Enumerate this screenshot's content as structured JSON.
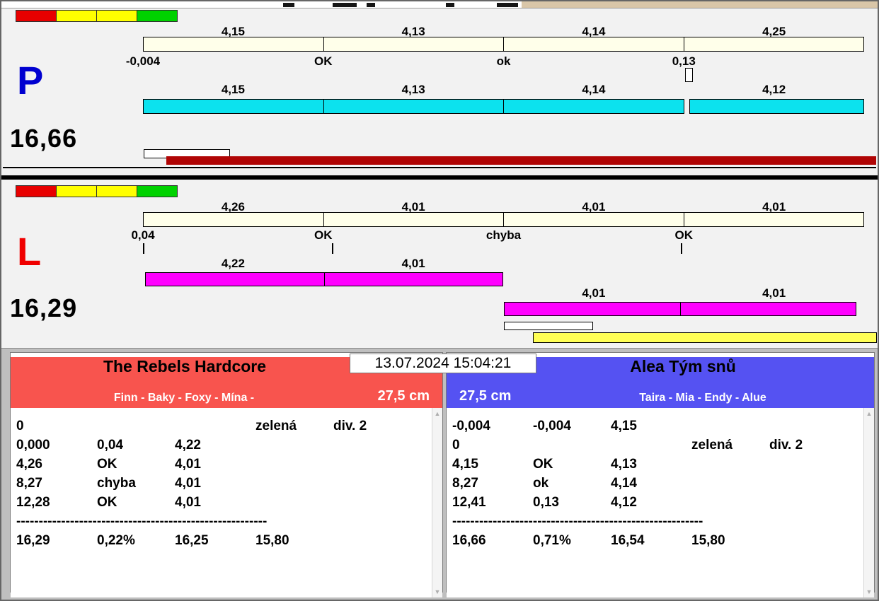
{
  "colors": {
    "section_bg": "#f2f2f2",
    "bottom_bg": "#bfbfbf",
    "cream_bar": "#ffffea",
    "cyan_bar": "#0ce2ee",
    "magenta_bar": "#ff00ff",
    "red_progress": "#b00505",
    "yellow_progress": "#ffff55",
    "left_header": "#f8544e",
    "right_header": "#5552f2",
    "p_letter": "#0000d0",
    "l_letter": "#f00000",
    "tan_strip": "#d9c6a8",
    "lights": [
      "#e80000",
      "#ffff00",
      "#ffff00",
      "#00d200"
    ]
  },
  "lane_p": {
    "label": "P",
    "total": "16,66",
    "split_values": [
      "4,15",
      "4,13",
      "4,14",
      "4,25"
    ],
    "status_values": [
      "-0,004",
      "OK",
      "ok",
      "0,13"
    ],
    "time_values": [
      "4,15",
      "4,13",
      "4,14",
      "4,12"
    ]
  },
  "lane_l": {
    "label": "L",
    "total": "16,29",
    "split_values": [
      "4,26",
      "4,01",
      "4,01",
      "4,01"
    ],
    "status_values": [
      "0,04",
      "OK",
      "chyba",
      "OK"
    ],
    "bar1_values": [
      "4,22",
      "4,01"
    ],
    "bar2_values": [
      "4,01",
      "4,01"
    ]
  },
  "timestamp": "13.07.2024 15:04:21",
  "team_left": {
    "name": "The Rebels Hardcore",
    "members": "Finn - Baky - Foxy - Mína -",
    "height": "27,5 cm",
    "rows": [
      [
        "0",
        "",
        "",
        "zelená",
        "div. 2"
      ],
      [
        "0,000",
        "0,04",
        "4,22",
        "",
        ""
      ],
      [
        "4,26",
        "OK",
        "4,01",
        "",
        ""
      ],
      [
        "8,27",
        "chyba",
        "4,01",
        "",
        ""
      ],
      [
        "12,28",
        "OK",
        "4,01",
        "",
        ""
      ],
      [
        "--------------------------------------------------------"
      ],
      [
        "16,29",
        "0,22%",
        "16,25",
        "15,80",
        ""
      ]
    ]
  },
  "team_right": {
    "name": "Alea Tým snů",
    "members": "Taira - Mia - Endy - Alue",
    "height": "27,5 cm",
    "rows": [
      [
        "-0,004",
        "-0,004",
        "4,15",
        "",
        ""
      ],
      [
        "0",
        "",
        "",
        "zelená",
        "div. 2"
      ],
      [
        "4,15",
        "OK",
        "4,13",
        "",
        ""
      ],
      [
        "8,27",
        "ok",
        "4,14",
        "",
        ""
      ],
      [
        "12,41",
        "0,13",
        "4,12",
        "",
        ""
      ],
      [
        "--------------------------------------------------------"
      ],
      [
        "16,66",
        "0,71%",
        "16,54",
        "15,80",
        ""
      ]
    ]
  }
}
